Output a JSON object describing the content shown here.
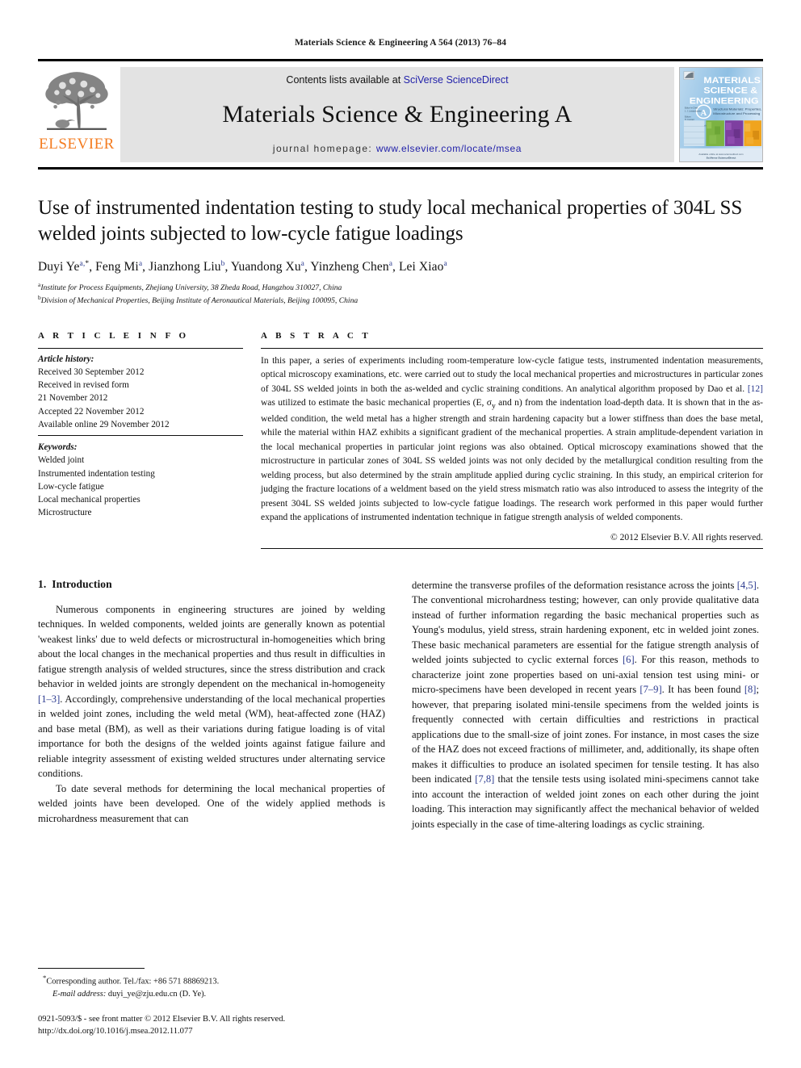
{
  "running_head": "Materials Science & Engineering A 564 (2013) 76–84",
  "masthead": {
    "publisher_logo_text": "ELSEVIER",
    "contents_prefix": "Contents lists available at ",
    "contents_link": "SciVerse ScienceDirect",
    "journal_title": "Materials Science & Engineering A",
    "homepage_label": "journal homepage: ",
    "homepage_url": "www.elsevier.com/locate/msea",
    "cover": {
      "line1": "MATERIALS",
      "line2": "SCIENCE &",
      "line3": "ENGINEERING",
      "series_letter": "A",
      "subtitle": "Structural Materials: Properties, Microstructure and Processing"
    }
  },
  "article": {
    "title": "Use of instrumented indentation testing to study local mechanical properties of 304L SS welded joints subjected to low-cycle fatigue loadings",
    "authors": [
      {
        "name": "Duyi Ye",
        "sup": "a,",
        "star": true
      },
      {
        "name": "Feng Mi",
        "sup": "a"
      },
      {
        "name": "Jianzhong Liu",
        "sup": "b"
      },
      {
        "name": "Yuandong Xu",
        "sup": "a"
      },
      {
        "name": "Yinzheng Chen",
        "sup": "a"
      },
      {
        "name": "Lei Xiao",
        "sup": "a"
      }
    ],
    "affiliations": [
      {
        "sup": "a",
        "text": "Institute for Process Equipments, Zhejiang University, 38 Zheda Road, Hangzhou 310027, China"
      },
      {
        "sup": "b",
        "text": "Division of Mechanical Properties, Beijing Institute of Aeronautical Materials, Beijing 100095, China"
      }
    ]
  },
  "article_info": {
    "heading": "A R T I C L E   I N F O",
    "history_label": "Article history:",
    "history": [
      "Received 30 September 2012",
      "Received in revised form",
      "21 November 2012",
      "Accepted 22 November 2012",
      "Available online 29 November 2012"
    ],
    "keywords_label": "Keywords:",
    "keywords": [
      "Welded joint",
      "Instrumented indentation testing",
      "Low-cycle fatigue",
      "Local mechanical properties",
      "Microstructure"
    ]
  },
  "abstract": {
    "heading": "A B S T R A C T",
    "part1": "In this paper, a series of experiments including room-temperature low-cycle fatigue tests, instrumented indentation measurements, optical microscopy examinations, etc. were carried out to study the local mechanical properties and microstructures in particular zones of 304L SS welded joints in both the as-welded and cyclic straining conditions. An analytical algorithm proposed by Dao et al. ",
    "ref1": "[12]",
    "part2": " was utilized to estimate the basic mechanical properties (E, σ",
    "sub_y": "y",
    "part3": " and n) from the indentation load-depth data. It is shown that in the as-welded condition, the weld metal has a higher strength and strain hardening capacity but a lower stiffness than does the base metal, while the material within HAZ exhibits a significant gradient of the mechanical properties. A strain amplitude-dependent variation in the local mechanical properties in particular joint regions was also obtained. Optical microscopy examinations showed that the microstructure in particular zones of 304L SS welded joints was not only decided by the metallurgical condition resulting from the welding process, but also determined by the strain amplitude applied during cyclic straining. In this study, an empirical criterion for judging the fracture locations of a weldment based on the yield stress mismatch ratio was also introduced to assess the integrity of the present 304L SS welded joints subjected to low-cycle fatigue loadings. The research work performed in this paper would further expand the applications of instrumented indentation technique in fatigue strength analysis of welded components.",
    "copyright": "© 2012 Elsevier B.V. All rights reserved."
  },
  "introduction": {
    "section_number": "1.",
    "section_title": "Introduction",
    "left_paragraph_1_a": "Numerous components in engineering structures are joined by welding techniques. In welded components, welded joints are generally known as potential 'weakest links' due to weld defects or microstructural in-homogeneities which bring about the local changes in the mechanical properties and thus result in difficulties in fatigue strength analysis of welded structures, since the stress distribution and crack behavior in welded joints are strongly dependent on the mechanical in-homogeneity ",
    "left_paragraph_1_ref": "[1–3]",
    "left_paragraph_1_b": ". Accordingly, comprehensive understanding of the local mechanical properties in welded joint zones, including the weld metal (WM), heat-affected zone (HAZ) and base metal (BM), as well as their variations during fatigue loading is of vital importance for both the designs of the welded joints against fatigue failure and reliable integrity assessment of existing welded structures under alternating service conditions.",
    "left_paragraph_2": "To date several methods for determining the local mechanical properties of welded joints have been developed. One of the widely applied methods is microhardness measurement that can",
    "right_a": "determine the transverse profiles of the deformation resistance across the joints ",
    "right_ref1": "[4,5]",
    "right_b": ". The conventional microhardness testing; however, can only provide qualitative data instead of further information regarding the basic mechanical properties such as Young's modulus, yield stress, strain hardening exponent, etc in welded joint zones. These basic mechanical parameters are essential for the fatigue strength analysis of welded joints subjected to cyclic external forces ",
    "right_ref2": "[6]",
    "right_c": ". For this reason, methods to characterize joint zone properties based on uni-axial tension test using mini- or micro-specimens have been developed in recent years ",
    "right_ref3": "[7–9]",
    "right_d": ". It has been found ",
    "right_ref4": "[8]",
    "right_e": "; however, that preparing isolated mini-tensile specimens from the welded joints is frequently connected with certain difficulties and restrictions in practical applications due to the small-size of joint zones. For instance, in most cases the size of the HAZ does not exceed fractions of millimeter, and, additionally, its shape often makes it difficulties to produce an isolated specimen for tensile testing. It has also been indicated ",
    "right_ref5": "[7,8]",
    "right_f": " that the tensile tests using isolated mini-specimens cannot take into account the interaction of welded joint zones on each other during the joint loading. This interaction may significantly affect the mechanical behavior of welded joints especially in the case of time-altering loadings as cyclic straining."
  },
  "footer": {
    "corresponding_marker": "*",
    "corresponding": "Corresponding author. Tel./fax: +86 571 88869213.",
    "email_label": "E-mail address:",
    "email": " duyi_ye@zju.edu.cn (D. Ye).",
    "issn_line": "0921-5093/$ - see front matter © 2012 Elsevier B.V. All rights reserved.",
    "doi_line": "http://dx.doi.org/10.1016/j.msea.2012.11.077"
  },
  "colors": {
    "elsevier_orange": "#f47c20",
    "link_blue": "#2222aa",
    "ref_blue": "#2b3a8f",
    "band_gray": "#e3e3e3"
  }
}
